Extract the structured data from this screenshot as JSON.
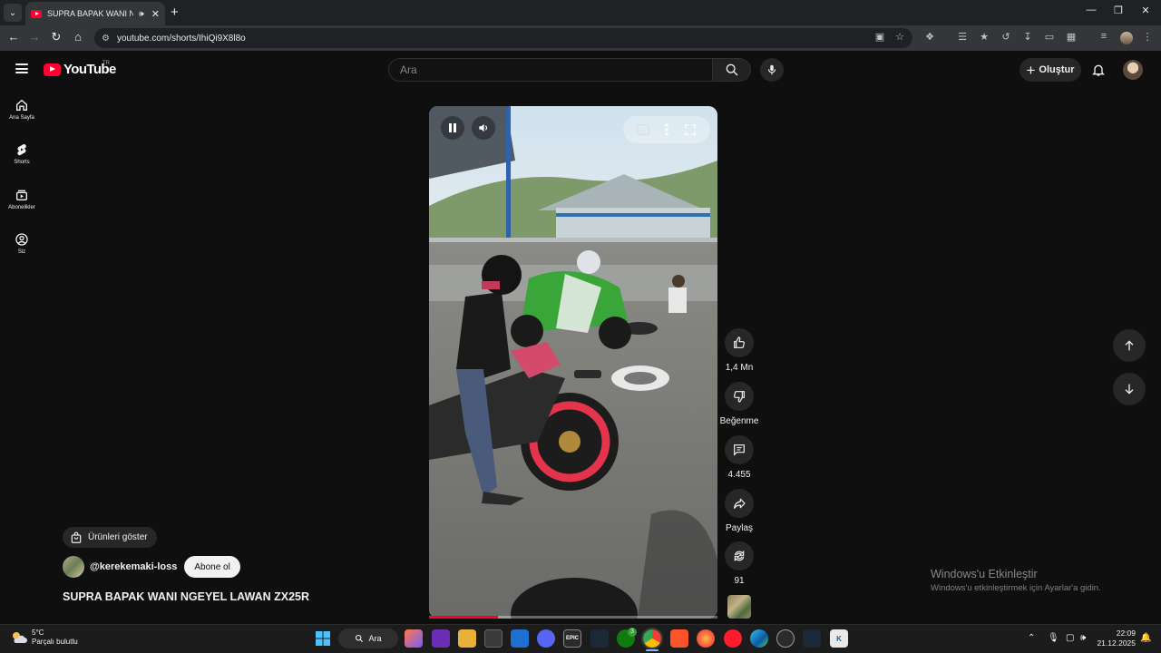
{
  "browser": {
    "tab_title": "SUPRA BAPAK WANI NGEYEL LAWAN ZX25R",
    "url": "youtube.com/shorts/IhiQi9X8l8o"
  },
  "header": {
    "logo_text": "YouTube",
    "country_code": "TR",
    "search_placeholder": "Ara",
    "create_label": "Oluştur"
  },
  "sidebar": {
    "items": [
      {
        "label": "Ana Sayfa",
        "icon": "home-icon"
      },
      {
        "label": "Shorts",
        "icon": "shorts-icon"
      },
      {
        "label": "Abonelikler",
        "icon": "subscriptions-icon"
      },
      {
        "label": "Siz",
        "icon": "you-icon"
      }
    ]
  },
  "video": {
    "title": "SUPRA BAPAK WANI NGEYEL LAWAN ZX25R",
    "channel": "@kerekemaki-loss",
    "subscribe_label": "Abone ol",
    "products_label": "Ürünleri göster",
    "progress": 0.24
  },
  "actions": {
    "likes": "1,4 Mn",
    "dislike_label": "Beğenme",
    "comments": "4.455",
    "share_label": "Paylaş",
    "remix_count": "91"
  },
  "watermark": {
    "title": "Windows'u Etkinleştir",
    "subtitle": "Windows'u etkinleştirmek için Ayarlar'a gidin."
  },
  "taskbar": {
    "temperature": "5°C",
    "weather": "Parçalı bulutlu",
    "search_label": "Ara",
    "time": "22:09",
    "date": "21.12.2025",
    "xbox_badge": "3"
  },
  "colors": {
    "accent": "#ff0033",
    "background": "#0f0f0f",
    "surface": "#272727"
  }
}
